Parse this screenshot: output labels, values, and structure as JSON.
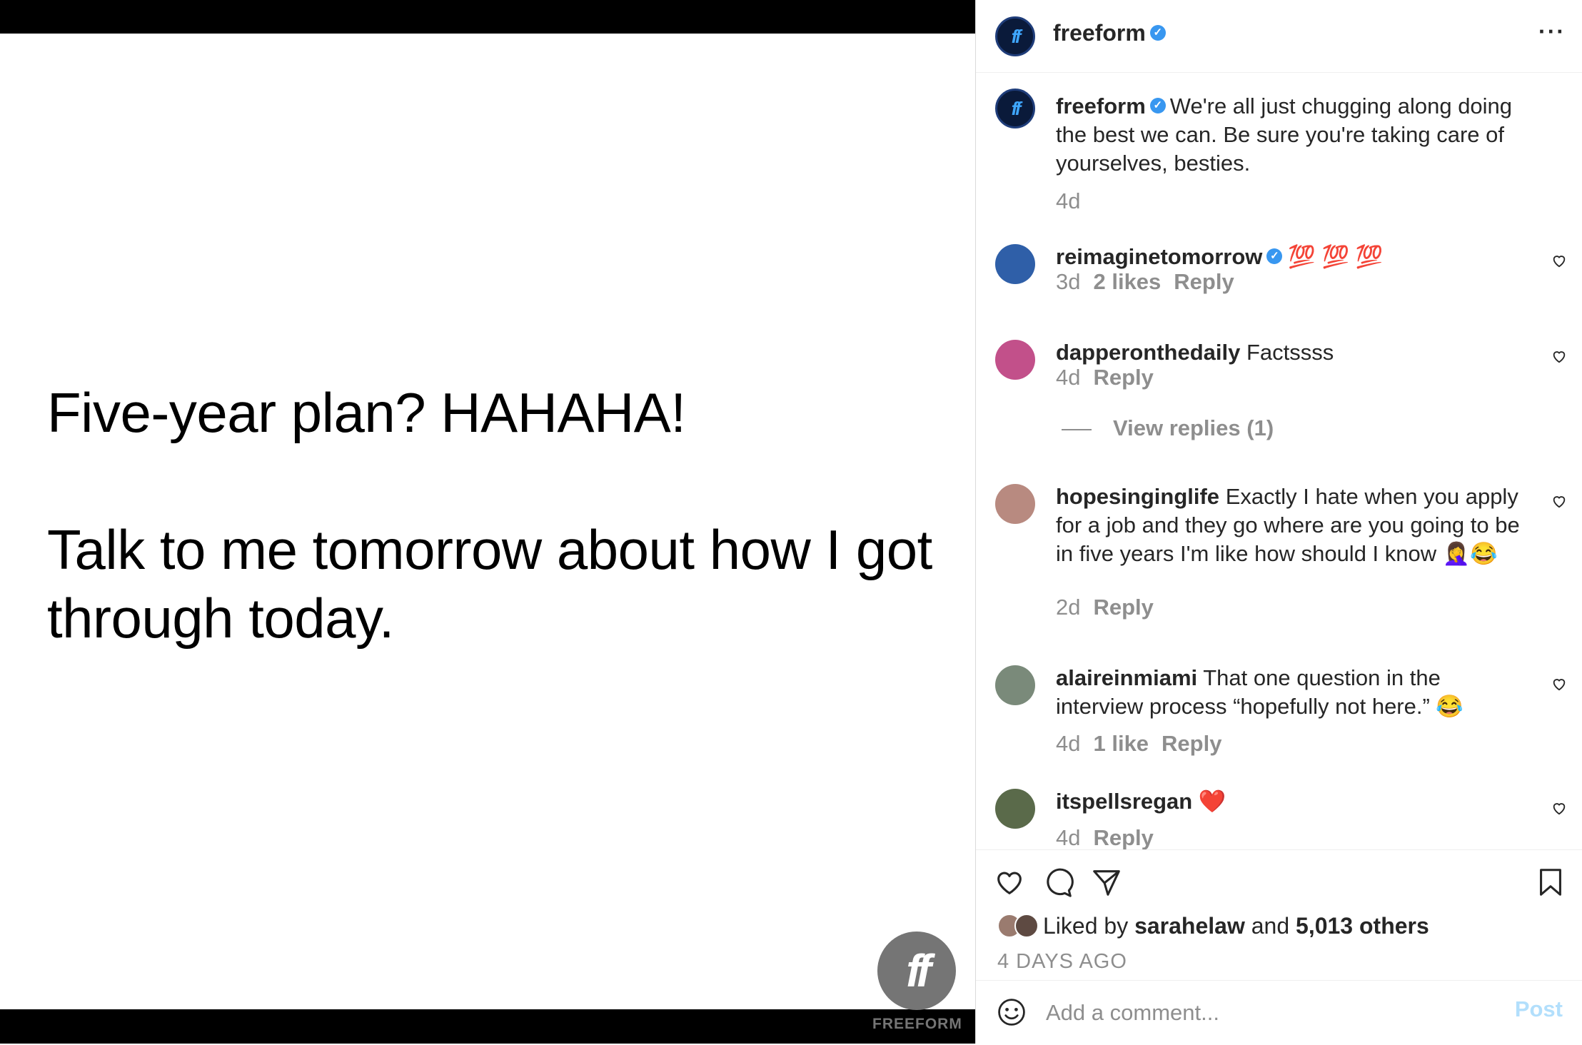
{
  "post_image": {
    "line1": "Five-year plan? HAHAHA!",
    "line2": "Talk to me tomorrow about how I got through today.",
    "logo_mark": "ff",
    "logo_word": "FREEFORM"
  },
  "header": {
    "username": "freeform",
    "verified_icon": "verified-badge-icon",
    "more_icon": "more-options-icon",
    "more_label": "···"
  },
  "caption": {
    "username": "freeform",
    "text": "We're all just chugging along doing the best we can. Be sure you're taking care of yourselves, besties.",
    "time": "4d"
  },
  "comments": [
    {
      "username": "reimaginetomorrow",
      "verified": true,
      "text": "💯 💯 💯",
      "time": "3d",
      "likes": "2 likes",
      "reply": "Reply",
      "avatar_color": "#2f5fa8"
    },
    {
      "username": "dapperonthedaily",
      "verified": false,
      "text": "Factssss",
      "time": "4d",
      "likes": "",
      "reply": "Reply",
      "avatar_color": "#c2508a",
      "view_replies": "View replies (1)"
    },
    {
      "username": "hopesinginglife",
      "verified": false,
      "text": "Exactly I hate when you apply for a job and they go where are you going to be in five years I'm like how should I know 🤦‍♀️😂",
      "time": "2d",
      "likes": "",
      "reply": "Reply",
      "avatar_color": "#b88a80"
    },
    {
      "username": "alaireinmiami",
      "verified": false,
      "text": "That one question in the interview process “hopefully not here.” 😂",
      "time": "4d",
      "likes": "1 like",
      "reply": "Reply",
      "avatar_color": "#7a8a7a"
    },
    {
      "username": "itspellsregan",
      "verified": false,
      "text": "❤️",
      "time": "4d",
      "likes": "",
      "reply": "Reply",
      "avatar_color": "#5a6a4a"
    }
  ],
  "actions": {
    "like_icon": "heart-icon",
    "comment_icon": "comment-icon",
    "share_icon": "send-icon",
    "save_icon": "bookmark-icon"
  },
  "likes": {
    "prefix": "Liked by",
    "user": "sarahelaw",
    "joiner": "and",
    "others": "5,013 others"
  },
  "post_date": "4 DAYS AGO",
  "comment_box": {
    "emoji_icon": "emoji-icon",
    "placeholder": "Add a comment...",
    "post_label": "Post"
  },
  "colors": {
    "verified": "#3897f0",
    "muted": "#8e8e8e",
    "post_button_disabled": "#b2dffc"
  }
}
